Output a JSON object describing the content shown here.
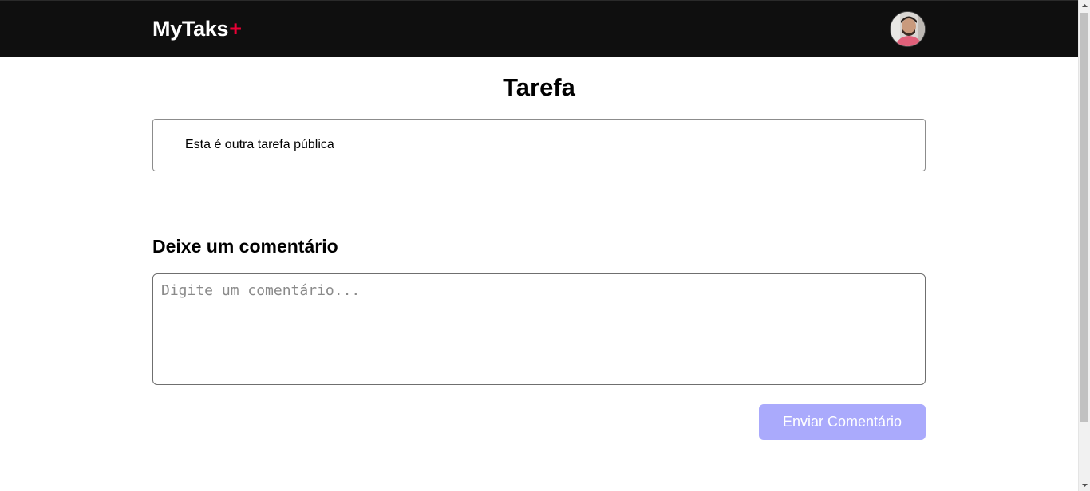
{
  "header": {
    "logo_text": "MyTaks",
    "logo_plus": "+",
    "avatar_icon": "user-avatar"
  },
  "main": {
    "title": "Tarefa",
    "task_text": "Esta é outra tarefa pública",
    "comment_heading": "Deixe um comentário",
    "comment_placeholder": "Digite um comentário...",
    "comment_value": "",
    "send_label": "Enviar Comentário"
  },
  "colors": {
    "header_bg": "#0f0f0f",
    "accent_plus": "#ea0036",
    "button_bg": "#aaaafc"
  }
}
